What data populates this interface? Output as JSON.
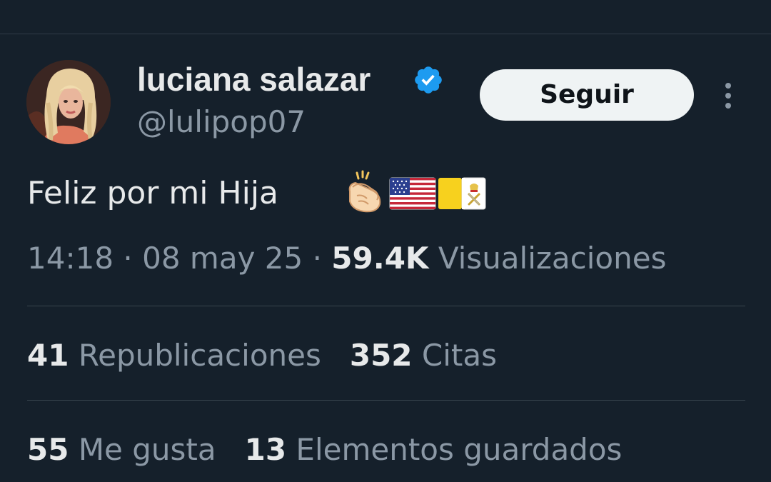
{
  "tweet": {
    "author": {
      "display_name": "luciana salazar",
      "handle": "@lulipop07",
      "verified": true
    },
    "follow_label": "Seguir",
    "text": "Feliz por mi Hija",
    "emojis": [
      "clapping-hands-emoji",
      "us-flag-emoji",
      "vatican-flag-emoji"
    ],
    "time": "14:18",
    "date": "08 may 25",
    "separator": "·",
    "views_count": "59.4K",
    "views_label": "Visualizaciones",
    "stats": {
      "reposts_count": "41",
      "reposts_label": "Republicaciones",
      "quotes_count": "352",
      "quotes_label": "Citas",
      "likes_count": "55",
      "likes_label": "Me gusta",
      "bookmarks_count": "13",
      "bookmarks_label": "Elementos guardados"
    }
  },
  "icons": {
    "verified": "verified-badge-icon",
    "more": "more-vertical-icon"
  },
  "colors": {
    "background": "#15202b",
    "primary_text": "#e7e9ea",
    "secondary_text": "#8b98a5",
    "verified_blue": "#1d9bf0",
    "button_bg": "#eff3f4",
    "button_text": "#0f1419",
    "divider": "#38444d"
  }
}
